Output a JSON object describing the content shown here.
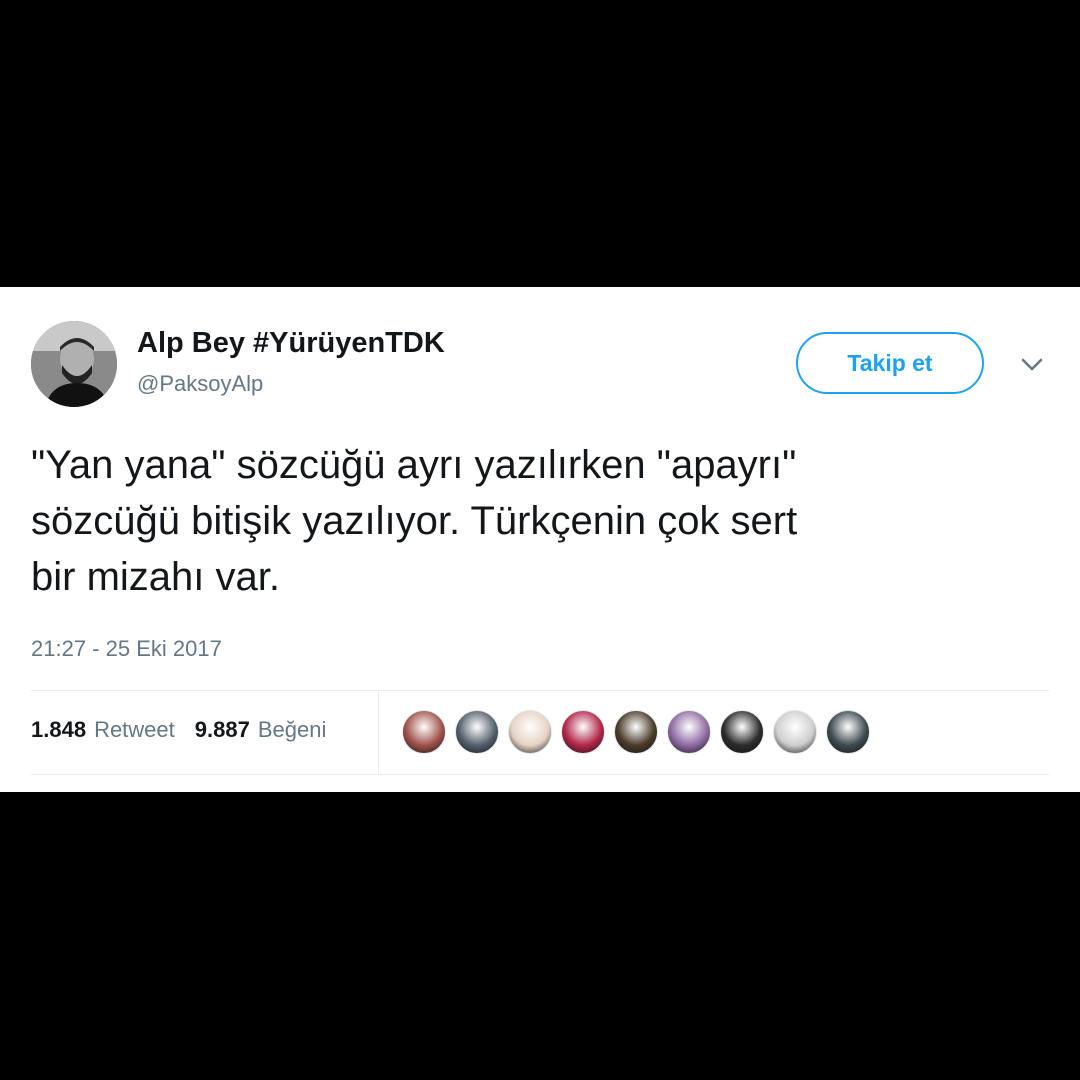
{
  "tweet": {
    "author": {
      "display_name": "Alp Bey #YürüyenTDK",
      "handle": "@PaksoyAlp"
    },
    "follow_label": "Takip et",
    "text_lines": [
      "\"Yan yana\" sözcüğü ayrı yazılırken \"apayrı\"",
      "sözcüğü bitişik yazılıyor. Türkçenin çok sert",
      "bir mizahı var."
    ],
    "timestamp": "21:27 - 25 Eki 2017",
    "stats": {
      "retweet_count": "1.848",
      "retweet_label": "Retweet",
      "like_count": "9.887",
      "like_label": "Beğeni"
    },
    "liker_avatars": [
      {
        "name": "liker-avatar-1",
        "color": "#a0524a"
      },
      {
        "name": "liker-avatar-2",
        "color": "#55606c"
      },
      {
        "name": "liker-avatar-3",
        "color": "#e7d2c4"
      },
      {
        "name": "liker-avatar-4",
        "color": "#b3264a"
      },
      {
        "name": "liker-avatar-5",
        "color": "#4a3b2a"
      },
      {
        "name": "liker-avatar-6",
        "color": "#8f6ba2"
      },
      {
        "name": "liker-avatar-7",
        "color": "#2c2c2c"
      },
      {
        "name": "liker-avatar-8",
        "color": "#cfcfcf"
      },
      {
        "name": "liker-avatar-9",
        "color": "#3e4a4f"
      }
    ]
  },
  "icons": {
    "caret": "chevron-down-icon"
  },
  "colors": {
    "accent": "#1da1f2",
    "text_primary": "#14171a",
    "text_secondary": "#657786",
    "background": "#000000",
    "card": "#ffffff"
  }
}
